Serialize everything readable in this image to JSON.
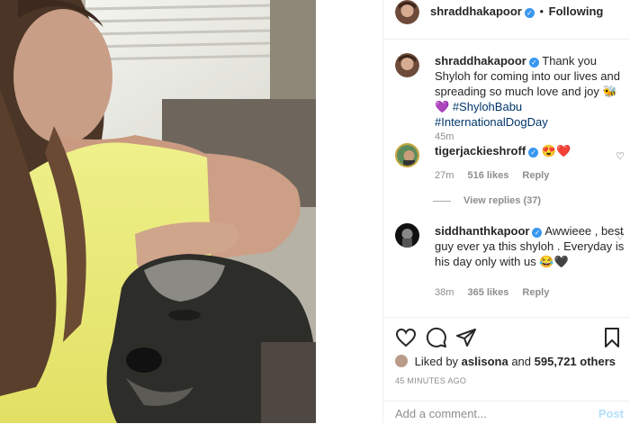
{
  "header": {
    "username": "shraddhakapoor",
    "separator": "•",
    "follow_status": "Following"
  },
  "caption": {
    "username": "shraddhakapoor",
    "text": "Thank you Shyloh for coming into our lives and spreading so much love and joy 🐝💜",
    "hashtags": "#ShylohBabu #InternationalDogDay",
    "time": "45m"
  },
  "comments": [
    {
      "username": "tigerjackieshroff",
      "text": "😍❤️",
      "time": "27m",
      "likes": "516 likes",
      "reply": "Reply"
    },
    {
      "username": "siddhanthkapoor",
      "text": "Awwieee , best guy ever ya this shyloh . Everyday is his day only with us 😂🖤",
      "time": "38m",
      "likes": "365 likes",
      "reply": "Reply"
    }
  ],
  "view_replies": "View replies (37)",
  "liked_by": {
    "prefix": "Liked by",
    "user": "aslisona",
    "middle": "and",
    "others": "595,721 others"
  },
  "timestamp": "45 MINUTES AGO",
  "add_comment": {
    "placeholder": "Add a comment...",
    "post_label": "Post"
  },
  "colors": {
    "link": "#00376b",
    "verified": "#3897f0",
    "muted": "#8e8e8e",
    "post_disabled": "#b2dffc"
  }
}
